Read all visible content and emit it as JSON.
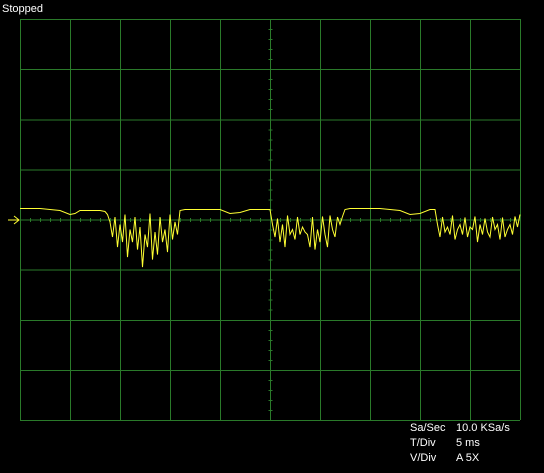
{
  "status": {
    "text": "Stopped"
  },
  "scope": {
    "divisions": {
      "x": 10,
      "y": 8
    },
    "grid_color": "#2a7a2a",
    "trace_color": "#ffff33",
    "marker_color": "#ffff33",
    "marker_icon": "ground-level-arrow-icon"
  },
  "readout": {
    "sample_rate": {
      "label": "Sa/Sec",
      "value": "10.0 KSa/s"
    },
    "time_div": {
      "label": "T/Div",
      "value": "5 ms"
    },
    "volt_div": {
      "label": "V/Div",
      "value": "A 5X"
    }
  },
  "chart_data": {
    "type": "line",
    "title": "",
    "xlabel": "",
    "ylabel": "",
    "xlim": [
      0,
      10
    ],
    "ylim": [
      -4,
      4
    ],
    "grid": true,
    "series": [
      {
        "x": [
          0.0,
          0.4,
          0.8,
          1.0,
          1.1,
          1.2,
          1.4,
          1.6,
          1.7,
          1.75,
          1.8,
          1.85,
          1.9,
          1.95,
          2.0,
          2.05,
          2.1,
          2.15,
          2.2,
          2.25,
          2.3,
          2.35,
          2.4,
          2.45,
          2.5,
          2.55,
          2.6,
          2.65,
          2.7,
          2.75,
          2.8,
          2.85,
          2.9,
          2.95,
          3.0,
          3.05,
          3.1,
          3.15,
          3.2,
          3.3,
          3.5,
          3.8,
          4.0,
          4.2,
          4.4,
          4.6,
          4.8,
          5.0,
          5.05,
          5.1,
          5.15,
          5.2,
          5.25,
          5.3,
          5.35,
          5.4,
          5.45,
          5.5,
          5.55,
          5.6,
          5.65,
          5.7,
          5.75,
          5.8,
          5.85,
          5.9,
          5.95,
          6.0,
          6.05,
          6.1,
          6.15,
          6.2,
          6.25,
          6.3,
          6.35,
          6.4,
          6.45,
          6.5,
          6.6,
          6.8,
          7.0,
          7.2,
          7.4,
          7.6,
          7.8,
          8.0,
          8.2,
          8.3,
          8.35,
          8.4,
          8.45,
          8.5,
          8.55,
          8.6,
          8.65,
          8.7,
          8.75,
          8.8,
          8.85,
          8.9,
          8.95,
          9.0,
          9.05,
          9.1,
          9.15,
          9.2,
          9.25,
          9.3,
          9.35,
          9.4,
          9.45,
          9.5,
          9.55,
          9.6,
          9.65,
          9.7,
          9.75,
          9.8,
          9.85,
          9.9,
          9.95,
          10.0
        ],
        "y": [
          0.22,
          0.22,
          0.18,
          0.1,
          0.12,
          0.18,
          0.18,
          0.18,
          0.16,
          0.1,
          -0.05,
          -0.35,
          0.05,
          -0.55,
          -0.1,
          -0.45,
          0.1,
          -0.75,
          -0.2,
          -0.45,
          0.05,
          -0.6,
          -0.15,
          -0.95,
          -0.3,
          -0.55,
          0.12,
          -0.8,
          -0.25,
          -0.7,
          0.05,
          -0.45,
          -0.2,
          -0.65,
          0.1,
          -0.4,
          -0.05,
          -0.3,
          0.18,
          0.2,
          0.2,
          0.2,
          0.2,
          0.12,
          0.14,
          0.2,
          0.2,
          0.2,
          -0.1,
          -0.35,
          0.02,
          -0.45,
          -0.1,
          -0.55,
          0.08,
          -0.3,
          -0.2,
          -0.4,
          0.05,
          -0.3,
          -0.15,
          -0.25,
          -0.3,
          -0.55,
          0.05,
          -0.6,
          -0.2,
          -0.45,
          0.06,
          -0.3,
          -0.55,
          0.08,
          -0.2,
          -0.35,
          0.05,
          -0.1,
          0.06,
          0.2,
          0.22,
          0.22,
          0.22,
          0.22,
          0.2,
          0.18,
          0.1,
          0.12,
          0.2,
          0.2,
          -0.1,
          -0.35,
          0.05,
          -0.25,
          -0.15,
          -0.3,
          0.08,
          -0.4,
          -0.2,
          -0.1,
          -0.3,
          0.04,
          -0.35,
          -0.15,
          -0.2,
          0.06,
          -0.45,
          -0.1,
          -0.3,
          0.02,
          -0.25,
          -0.35,
          0.05,
          -0.2,
          -0.1,
          -0.4,
          0.04,
          -0.35,
          -0.2,
          -0.1,
          -0.3,
          0.06,
          -0.15,
          0.1
        ]
      }
    ]
  }
}
